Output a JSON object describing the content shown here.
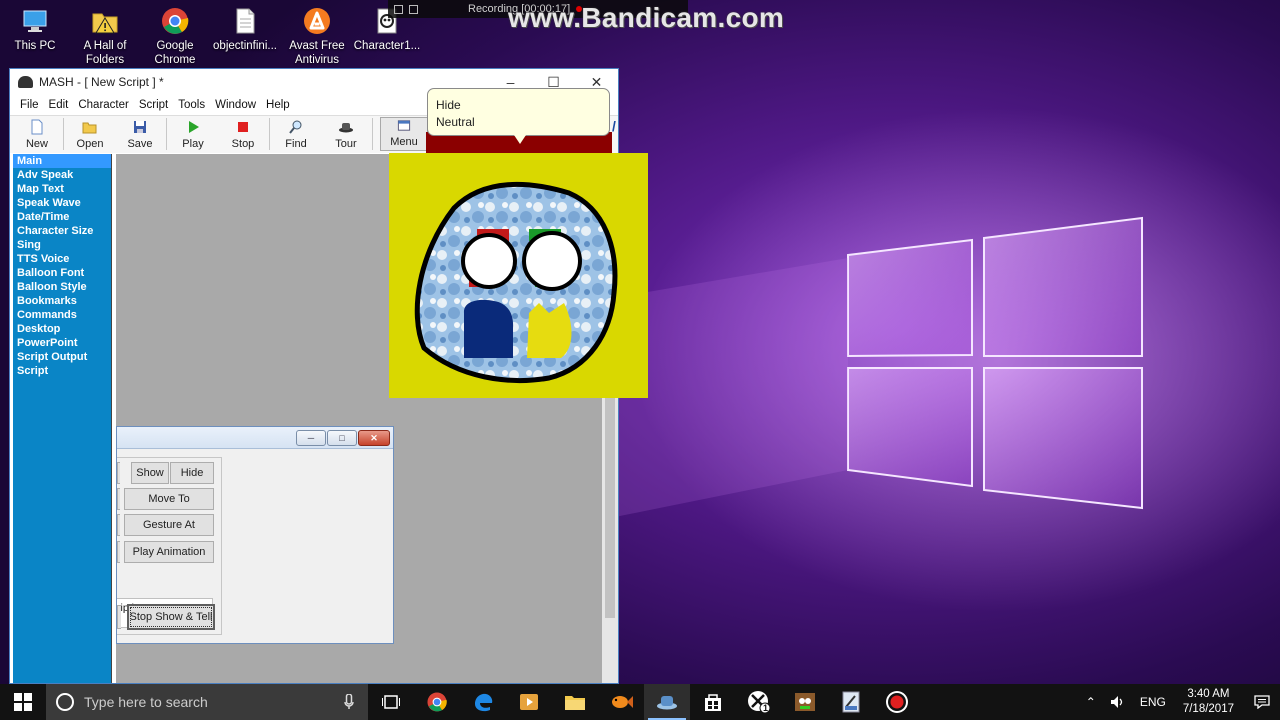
{
  "desktop": {
    "icons": [
      {
        "name": "this-pc",
        "label": "This PC"
      },
      {
        "name": "hall-of-folders",
        "label": "A Hall of Folders"
      },
      {
        "name": "google-chrome",
        "label": "Google Chrome"
      },
      {
        "name": "objectinfini",
        "label": "objectinfini..."
      },
      {
        "name": "avast",
        "label": "Avast Free Antivirus"
      },
      {
        "name": "character1",
        "label": "Character1..."
      }
    ],
    "recording_text": "Recording [00:00:17]",
    "watermark": "www.Bandicam.com"
  },
  "mash": {
    "title": "MASH - [ New Script ] *",
    "menu": [
      "File",
      "Edit",
      "Character",
      "Script",
      "Tools",
      "Window",
      "Help"
    ],
    "toolbar": {
      "new": "New",
      "open": "Open",
      "save": "Save",
      "play": "Play",
      "stop": "Stop",
      "find": "Find",
      "tour": "Tour",
      "menu": "Menu"
    },
    "sidebar": [
      "Main",
      "Adv Speak",
      "Map Text",
      "Speak Wave",
      "Date/Time",
      "Character Size",
      "Sing",
      "TTS Voice",
      "Balloon Font",
      "Balloon Style",
      "Bookmarks",
      "Commands",
      "Desktop",
      "PowerPoint",
      "Script Output",
      "Script"
    ],
    "active_sidebar": "Main"
  },
  "balloon": {
    "line1": "Hide",
    "line2": "Neutral"
  },
  "subdialog": {
    "show": "Show",
    "hide": "Hide",
    "move_to": "Move To",
    "gesture_at": "Gesture At",
    "play_animation": "Play Animation",
    "description": "ription!",
    "stop_show_tell": "Stop Show & Tell"
  },
  "taskbar": {
    "search_placeholder": "Type here to search",
    "language": "ENG",
    "time": "3:40 AM",
    "date": "7/18/2017",
    "xbox_badge": "1"
  },
  "colors": {
    "sidebar_bg": "#0a85c6",
    "character_bg": "#d9d800",
    "balloon_bg": "#ffffe1",
    "taskbar_bg": "#121212"
  }
}
